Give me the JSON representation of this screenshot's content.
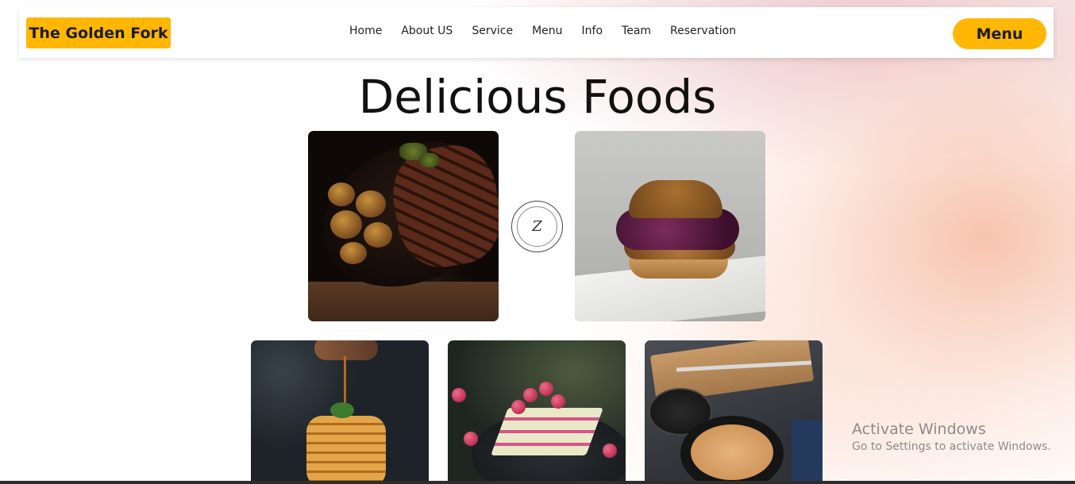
{
  "header": {
    "brand": "The Golden Fork",
    "nav": [
      "Home",
      "About US",
      "Service",
      "Menu",
      "Info",
      "Team",
      "Reservation"
    ],
    "menu_button": "Menu"
  },
  "hero": {
    "title": "Delicious Foods"
  },
  "gallery": {
    "top": [
      "steak-photo",
      "burger-photo"
    ],
    "logo_letter": "Z",
    "bottom": [
      "pancakes-photo",
      "cake-photo",
      "soup-photo"
    ]
  },
  "watermark": {
    "line1": "Activate Windows",
    "line2": "Go to Settings to activate Windows."
  },
  "colors": {
    "accent": "#ffb703"
  }
}
